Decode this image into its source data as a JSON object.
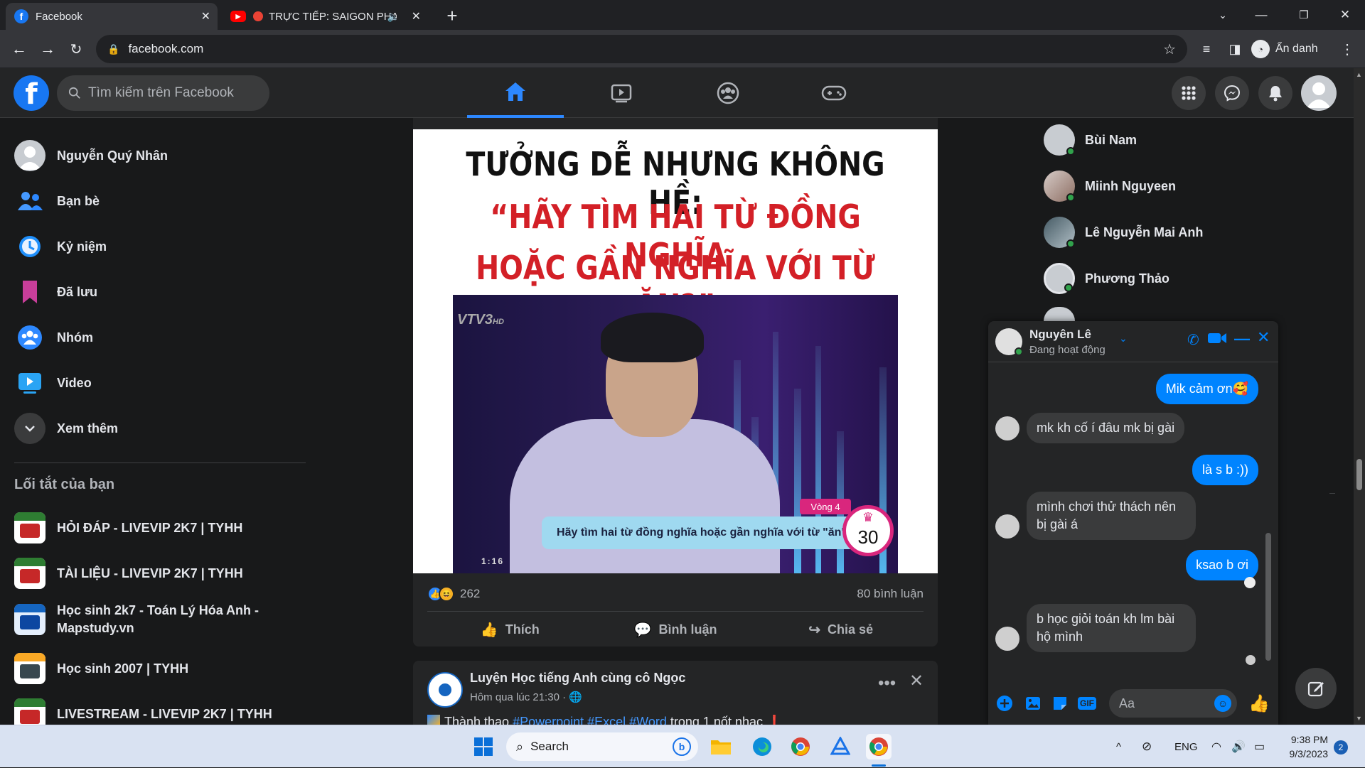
{
  "browser": {
    "tabs": [
      {
        "title": "Facebook",
        "active": true
      },
      {
        "title": "TRỰC TIẾP: SAIGON PHAI",
        "active": false
      }
    ],
    "url": "facebook.com",
    "profile_label": "Ẩn danh"
  },
  "fb": {
    "search_placeholder": "Tìm kiếm trên Facebook",
    "nav_tabs": [
      "home-icon",
      "watch-icon",
      "groups-icon",
      "gaming-icon"
    ],
    "accent": "#2d88ff"
  },
  "sidebar": {
    "items": [
      {
        "label": "Nguyễn Quý Nhân",
        "icon": "avatar"
      },
      {
        "label": "Bạn bè",
        "icon": "friends-icon"
      },
      {
        "label": "Kỷ niệm",
        "icon": "memories-icon"
      },
      {
        "label": "Đã lưu",
        "icon": "saved-icon"
      },
      {
        "label": "Nhóm",
        "icon": "groups-icon"
      },
      {
        "label": "Video",
        "icon": "video-icon"
      },
      {
        "label": "Xem thêm",
        "icon": "chevron-down-icon"
      }
    ],
    "shortcuts_title": "Lối tắt của bạn",
    "shortcuts": [
      "HỎI ĐÁP - LIVEVIP 2K7 | TYHH",
      "TÀI LIỆU - LIVEVIP 2K7 | TYHH",
      "Học sinh 2k7 - Toán Lý Hóa Anh - Mapstudy.vn",
      "Học sinh 2007 | TYHH",
      "LIVESTREAM - LIVEVIP 2K7 | TYHH"
    ]
  },
  "post1": {
    "headline_1": "TƯỞNG DỄ NHƯNG KHÔNG HỀ:",
    "headline_2": "“HÃY TÌM HAI TỪ ĐỒNG NGHĨA",
    "headline_3": "HOẶC GẦN NGHĨA VỚI TỪ ĂN?”",
    "video_logo": "VTV3",
    "video_logo_hd": "HD",
    "video_round": "Vòng 4",
    "video_caption": "Hãy tìm hai từ đồng nghĩa hoặc gần nghĩa với từ \"ăn\"",
    "video_score": "30",
    "video_time": "1:16",
    "reaction_count": "262",
    "comment_count": "80 bình luận",
    "actions": {
      "like": "Thích",
      "comment": "Bình luận",
      "share": "Chia sẻ"
    }
  },
  "post2": {
    "author": "Luyện Học tiếng Anh cùng cô Ngọc",
    "time": "Hôm qua lúc 21:30 · ",
    "text_start": "Thành thạo ",
    "hashtags": "#Powerpoint #Excel #Word",
    "text_end": " trong 1 nốt nhạc"
  },
  "contacts": [
    "Bùi Nam",
    "Miinh Nguyeen",
    "Lê Nguyễn Mai Anh",
    "Phương Thảo"
  ],
  "chat": {
    "name": "Nguyên Lê",
    "status": "Đang hoạt động",
    "messages": [
      {
        "from": "me",
        "text": "Mik cảm ơn🥰"
      },
      {
        "from": "them",
        "text": "mk kh cố í đâu mk bị gài"
      },
      {
        "from": "me",
        "text": "là s b :))"
      },
      {
        "from": "them",
        "text": "mình chơi thử thách nên bị gài á"
      },
      {
        "from": "me",
        "text": "ksao b ơi"
      },
      {
        "from": "them",
        "text": "b học giỏi toán kh lm bài hộ mình"
      }
    ],
    "input_placeholder": "Aa",
    "accent": "#0084ff"
  },
  "taskbar": {
    "search_label": "Search",
    "lang": "ENG",
    "time": "9:38 PM",
    "date": "9/3/2023",
    "notifications": "2"
  }
}
